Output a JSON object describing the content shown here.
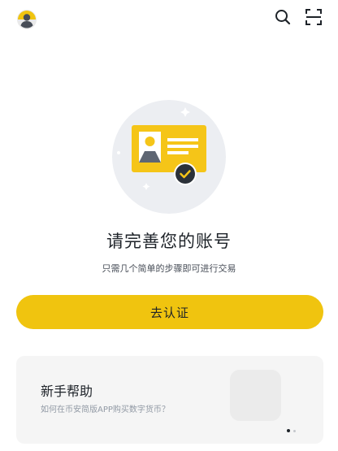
{
  "header": {
    "avatar_icon": "user-avatar-icon",
    "search_icon": "search-icon",
    "scan_icon": "scan-icon"
  },
  "verification": {
    "illustration_icon": "id-card-verified-icon",
    "title": "请完善您的账号",
    "subtitle": "只需几个简单的步骤即可进行交易",
    "button_label": "去认证"
  },
  "help_card": {
    "title": "新手帮助",
    "description": "如何在币安简版APP购买数字货币？",
    "page_count": 2,
    "active_page": 1
  },
  "colors": {
    "accent": "#f0c40f",
    "text_primary": "#1e2329",
    "text_secondary": "#474d57",
    "card_bg": "#f5f5f5"
  }
}
